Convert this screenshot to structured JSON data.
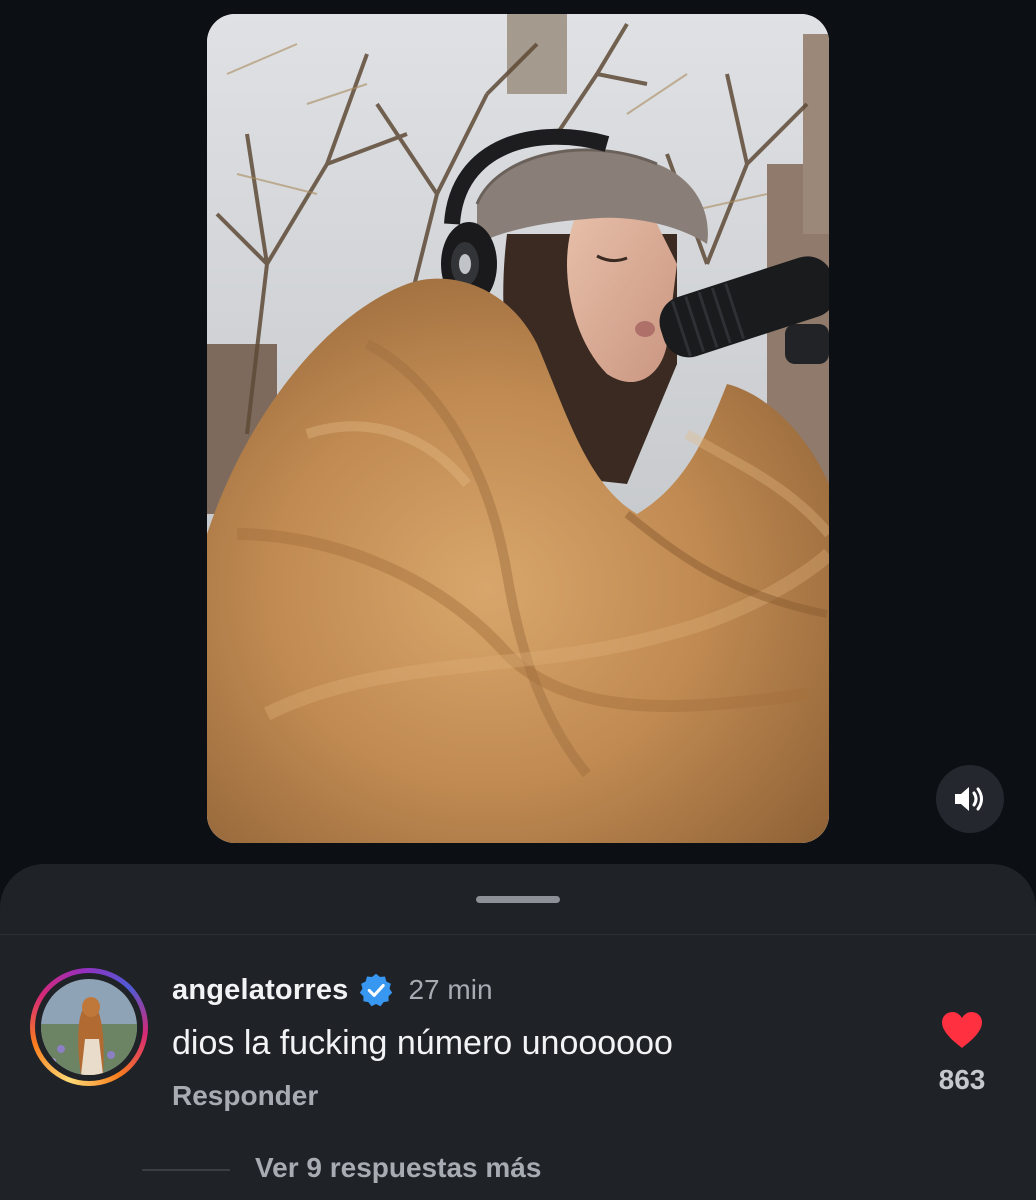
{
  "media": {
    "type": "video",
    "audio_icon": "speaker-volume-icon"
  },
  "comment": {
    "username": "angelatorres",
    "verified_icon": "verified-badge-icon",
    "timestamp": "27 min",
    "text": "dios la fucking número unoooooo",
    "reply_label": "Responder",
    "like_icon": "heart-filled-icon",
    "like_color": "#ff3040",
    "like_count": "863",
    "view_replies_label": "Ver 9 respuestas más"
  },
  "colors": {
    "background": "#0c0f13",
    "sheet": "#1f2227",
    "verified": "#3897f0"
  }
}
